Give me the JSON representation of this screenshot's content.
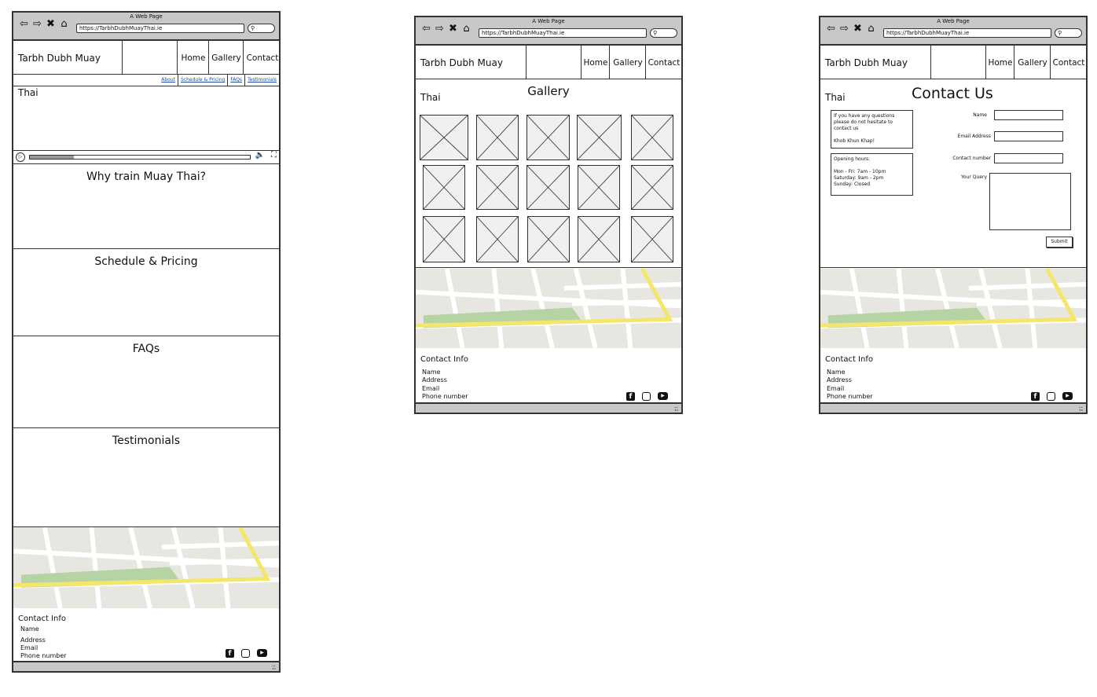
{
  "browser": {
    "window_title": "A Web Page",
    "url": "https://TarbhDubhMuayThai.ie"
  },
  "site": {
    "brand": "Tarbh Dubh Muay Thai",
    "nav": {
      "home": "Home",
      "gallery": "Gallery",
      "contact": "Contact"
    }
  },
  "home": {
    "subnav": [
      "About",
      "Schedule & Pricing",
      "FAQs",
      "Testimonials"
    ],
    "sections": [
      "Why train Muay Thai?",
      "Schedule & Pricing",
      "FAQs",
      "Testimonials"
    ]
  },
  "gallery": {
    "title": "Gallery"
  },
  "contact": {
    "title": "Contact Us",
    "intro_line1": "If you have any questions",
    "intro_line2": "please do not hesitate to",
    "intro_line3": "contact us",
    "intro_line4": "Khob Khun Khap!",
    "hours_title": "Opening hours:",
    "hours_1": "Mon - Fri: 7am - 10pm",
    "hours_2": "Saturday: 9am - 2pm",
    "hours_3": "Sunday: Closed",
    "labels": {
      "name": "Name",
      "email": "Email Address",
      "phone": "Contact number",
      "query": "Your Query"
    },
    "submit": "Submit"
  },
  "footer": {
    "title": "Contact Info",
    "name": "Name",
    "address": "Address",
    "email": "Email",
    "phone": "Phone number"
  },
  "icons": [
    "back-arrow-icon",
    "forward-arrow-icon",
    "close-icon",
    "home-icon",
    "search-icon",
    "play-icon",
    "volume-icon",
    "fullscreen-icon",
    "facebook-icon",
    "instagram-icon",
    "youtube-icon",
    "resize-grip-icon"
  ],
  "colors": {
    "chrome": "#c8c8c8",
    "map_road": "#ffffff",
    "map_bg": "#e8e6e0",
    "map_park": "#b6d3a3",
    "map_highway": "#f3e66b",
    "link": "#1a4ea0"
  }
}
